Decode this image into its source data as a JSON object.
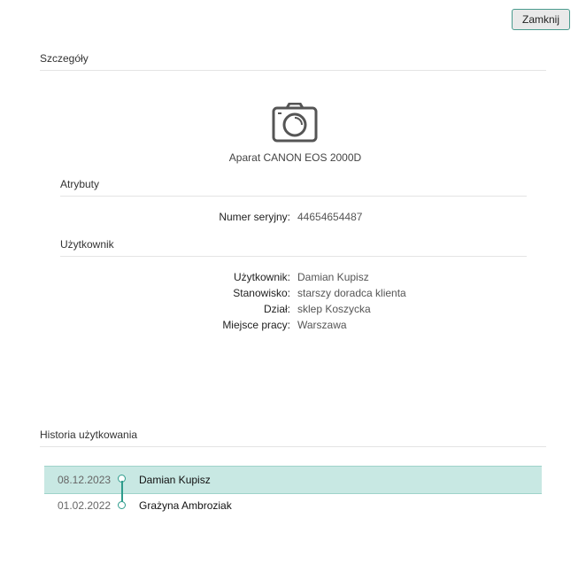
{
  "header": {
    "close_label": "Zamknij"
  },
  "details": {
    "title": "Szczegóły",
    "device_icon": "camera-icon",
    "device_name": "Aparat CANON EOS 2000D",
    "attributes": {
      "title": "Atrybuty",
      "serial_label": "Numer seryjny:",
      "serial_value": "44654654487"
    },
    "user": {
      "title": "Użytkownik",
      "fields": [
        {
          "label": "Użytkownik:",
          "value": "Damian Kupisz"
        },
        {
          "label": "Stanowisko:",
          "value": "starszy doradca klienta"
        },
        {
          "label": "Dział:",
          "value": "sklep Koszycka"
        },
        {
          "label": "Miejsce pracy:",
          "value": "Warszawa"
        }
      ]
    }
  },
  "history": {
    "title": "Historia użytkowania",
    "entries": [
      {
        "date": "08.12.2023",
        "name": "Damian Kupisz",
        "active": true
      },
      {
        "date": "01.02.2022",
        "name": "Grażyna Ambroziak",
        "active": false
      }
    ]
  },
  "colors": {
    "accent": "#2e9c8c",
    "active_row": "#c8e8e3"
  }
}
